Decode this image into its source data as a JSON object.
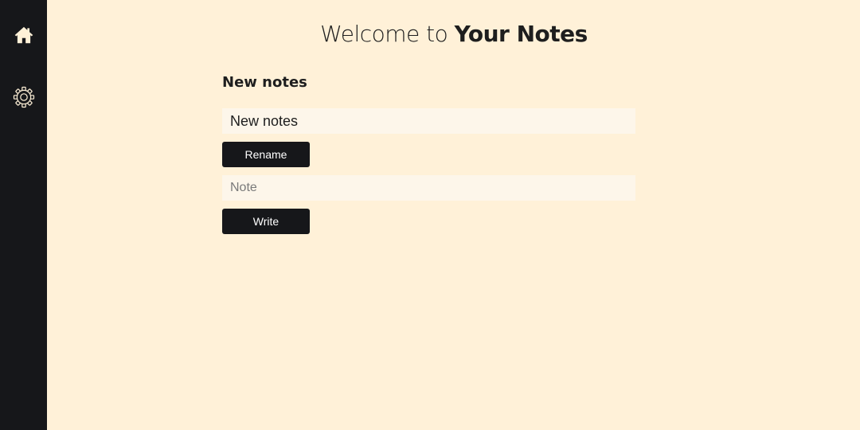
{
  "sidebar": {
    "items": [
      {
        "icon": "home-icon",
        "label": "Home"
      },
      {
        "icon": "gear-icon",
        "label": "Settings"
      }
    ],
    "background": "#16171a",
    "icon_color": "#fff1d8"
  },
  "header": {
    "title_prefix": "Welcome to ",
    "title_emphasis": "Your Notes"
  },
  "notebook": {
    "heading": "New notes",
    "name_value": "New notes",
    "rename_label": "Rename",
    "note_placeholder": "Note",
    "write_label": "Write"
  },
  "colors": {
    "background": "#fff1d8",
    "input_background": "#fdf6ea",
    "button_background": "#16171a",
    "text": "#1e1e1e"
  }
}
